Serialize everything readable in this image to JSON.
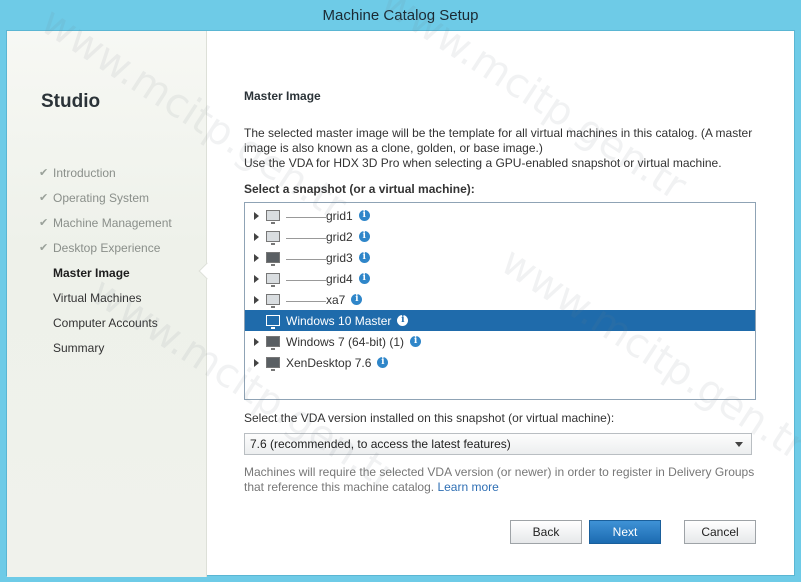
{
  "window": {
    "title": "Machine Catalog Setup"
  },
  "sidebar": {
    "brand": "Studio",
    "steps": [
      {
        "label": "Introduction",
        "state": "done"
      },
      {
        "label": "Operating System",
        "state": "done"
      },
      {
        "label": "Machine Management",
        "state": "done"
      },
      {
        "label": "Desktop Experience",
        "state": "done"
      },
      {
        "label": "Master Image",
        "state": "active"
      },
      {
        "label": "Virtual Machines",
        "state": "pending"
      },
      {
        "label": "Computer Accounts",
        "state": "pending"
      },
      {
        "label": "Summary",
        "state": "pending"
      }
    ]
  },
  "main": {
    "heading": "Master Image",
    "description_1": "The selected master image will be the template for all virtual machines in this catalog. (A master image is also known as a clone, golden, or base image.)",
    "description_2": "Use the VDA for HDX 3D Pro when selecting a GPU-enabled snapshot or virtual machine.",
    "select_label": "Select a snapshot (or a virtual machine):",
    "tree": [
      {
        "label": "grid1",
        "redacted": true,
        "expandable": true,
        "icon": "vm-light-icon"
      },
      {
        "label": "grid2",
        "redacted": true,
        "expandable": true,
        "icon": "vm-light-icon"
      },
      {
        "label": "grid3",
        "redacted": true,
        "expandable": true,
        "icon": "vm-dark-icon"
      },
      {
        "label": "grid4",
        "redacted": true,
        "expandable": true,
        "icon": "vm-light-icon"
      },
      {
        "label": "xa7",
        "redacted": true,
        "expandable": true,
        "icon": "vm-light-icon"
      },
      {
        "label": "Windows 10 Master",
        "redacted": false,
        "expandable": false,
        "icon": "vm-light-icon",
        "selected": true
      },
      {
        "label": "Windows 7 (64-bit) (1)",
        "redacted": false,
        "expandable": true,
        "icon": "vm-dark-icon"
      },
      {
        "label": "XenDesktop 7.6",
        "redacted": false,
        "expandable": true,
        "icon": "vm-dark-icon"
      }
    ],
    "vda_label": "Select the VDA version installed on this snapshot (or virtual machine):",
    "vda_selected": "7.6 (recommended, to access the latest features)",
    "note": "Machines will require the selected VDA version (or newer) in order to register in Delivery Groups that reference this machine catalog.",
    "learn_more": "Learn more"
  },
  "buttons": {
    "back": "Back",
    "next": "Next",
    "cancel": "Cancel"
  },
  "watermark": "www.mcitp.gen.tr",
  "colors": {
    "titlebar": "#6ecbe7",
    "selection": "#1f6bab",
    "info": "#2f86c9",
    "primary_button": "#1c6bb1"
  }
}
